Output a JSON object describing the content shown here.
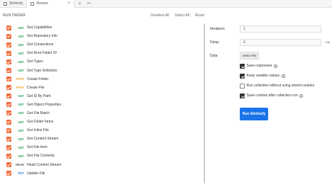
{
  "tabs": [
    {
      "label": "Simfoofy",
      "icon": "tab-icon"
    },
    {
      "label": "Runner",
      "icon": "runner-icon",
      "active": true
    }
  ],
  "tab_tools": {
    "add": "+",
    "more": "•••",
    "close": "×"
  },
  "header": {
    "title": "RUN ORDER",
    "deselect_all": "Deselect All",
    "select_all": "Select All",
    "reset": "Reset"
  },
  "requests": [
    {
      "method": "GET",
      "name": "Get Capabilities"
    },
    {
      "method": "GET",
      "name": "Get Repository Info"
    },
    {
      "method": "GET",
      "name": "Get Connections"
    },
    {
      "method": "GET",
      "name": "Get Root Folder ID"
    },
    {
      "method": "GET",
      "name": "Get Types"
    },
    {
      "method": "GET",
      "name": "Get Type Definition"
    },
    {
      "method": "POST",
      "name": "Create Folder"
    },
    {
      "method": "POST",
      "name": "Create File"
    },
    {
      "method": "GET",
      "name": "Get ID By Path"
    },
    {
      "method": "GET",
      "name": "Get Object Properties"
    },
    {
      "method": "GET",
      "name": "Get File Batch"
    },
    {
      "method": "GET",
      "name": "Get Folder Items"
    },
    {
      "method": "GET",
      "name": "Get Inline File"
    },
    {
      "method": "GET",
      "name": "Get Content Stream"
    },
    {
      "method": "GET",
      "name": "Get File Item"
    },
    {
      "method": "GET",
      "name": "Get File Contents"
    },
    {
      "method": "HEAD",
      "name": "Head Content Stream"
    },
    {
      "method": "PUT",
      "name": "Update File"
    }
  ],
  "settings": {
    "iterations_label": "Iterations",
    "iterations_value": "1",
    "delay_label": "Delay",
    "delay_value": "0",
    "delay_unit": "ms",
    "data_label": "Data",
    "select_file": "Select File",
    "options": [
      {
        "label": "Save responses",
        "checked": true,
        "info": true
      },
      {
        "label": "Keep variable values",
        "checked": true,
        "info": true
      },
      {
        "label": "Run collection without using stored cookies",
        "checked": false,
        "info": false
      },
      {
        "label": "Save cookies after collection run",
        "checked": true,
        "info": true
      }
    ],
    "run_button": "Run Simfoofy"
  },
  "colors": {
    "checkbox": "#f26b3a",
    "get": "#2aa05c",
    "post": "#e8a21a",
    "put": "#1f7ad6",
    "run_button": "#1a73e8"
  }
}
